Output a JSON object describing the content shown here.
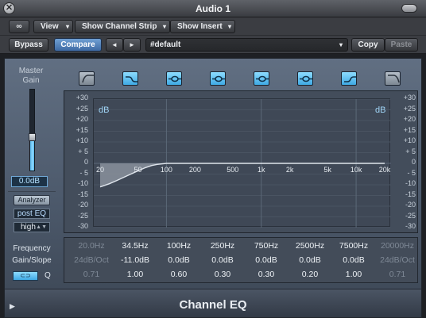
{
  "window": {
    "title": "Audio 1",
    "close_glyph": "✕"
  },
  "toolbar": {
    "link_glyph": "∞",
    "view_label": "View",
    "channel_strip_label": "Show Channel Strip",
    "insert_label": "Show Insert",
    "bypass_label": "Bypass",
    "compare_label": "Compare",
    "prev_glyph": "◄",
    "next_glyph": "►",
    "preset_value": "#default",
    "copy_label": "Copy",
    "paste_label": "Paste",
    "dropdown_glyph": "▾"
  },
  "master": {
    "label_line1": "Master",
    "label_line2": "Gain",
    "gain_value": "0.0dB",
    "fader_level": 0.42
  },
  "analyzer": {
    "button_label": "Analyzer",
    "mode_value": "post EQ",
    "quality_value": "high"
  },
  "bands": [
    {
      "icon": "low-cut-icon",
      "on": false
    },
    {
      "icon": "low-shelf-icon",
      "on": true
    },
    {
      "icon": "bell-icon",
      "on": true
    },
    {
      "icon": "bell-icon",
      "on": true
    },
    {
      "icon": "bell-icon",
      "on": true
    },
    {
      "icon": "bell-icon",
      "on": true
    },
    {
      "icon": "high-shelf-icon",
      "on": true
    },
    {
      "icon": "high-cut-icon",
      "on": false
    }
  ],
  "graph": {
    "db_ticks": [
      "+30",
      "+25",
      "+20",
      "+15",
      "+10",
      "+ 5",
      "0",
      "- 5",
      "-10",
      "-15",
      "-20",
      "-25",
      "-30"
    ],
    "freq_ticks": [
      "20",
      "50",
      "100",
      "200",
      "500",
      "1k",
      "2k",
      "5k",
      "10k",
      "20k"
    ],
    "unit_label": "dB",
    "accent_color": "#8fd8ff"
  },
  "chart_data": {
    "type": "line",
    "xlabel": "",
    "ylabel": "dB",
    "xscale": "log",
    "xlim": [
      20,
      20000
    ],
    "ylim": [
      -30,
      30
    ],
    "series": [
      {
        "x": [
          20,
          25,
          30,
          40,
          50,
          60,
          70,
          80,
          100,
          200,
          1000,
          20000
        ],
        "y": [
          -11,
          -9.5,
          -8,
          -5.5,
          -3.5,
          -2,
          -1,
          -0.5,
          0,
          0,
          0,
          0
        ]
      }
    ]
  },
  "params": {
    "row_labels": [
      "Frequency",
      "Gain/Slope"
    ],
    "link_toggle_glyph": "⊂⊃",
    "q_label": "Q",
    "frequency": [
      "20.0Hz",
      "34.5Hz",
      "100Hz",
      "250Hz",
      "750Hz",
      "2500Hz",
      "7500Hz",
      "20000Hz"
    ],
    "gain": [
      "24dB/Oct",
      "-11.0dB",
      "0.0dB",
      "0.0dB",
      "0.0dB",
      "0.0dB",
      "0.0dB",
      "24dB/Oct"
    ],
    "q": [
      "0.71",
      "1.00",
      "0.60",
      "0.30",
      "0.30",
      "0.20",
      "1.00",
      "0.71"
    ],
    "active": [
      false,
      true,
      true,
      true,
      true,
      true,
      true,
      false
    ]
  },
  "footer": {
    "plugin_name": "Channel EQ",
    "disclosure_glyph": "▶"
  }
}
